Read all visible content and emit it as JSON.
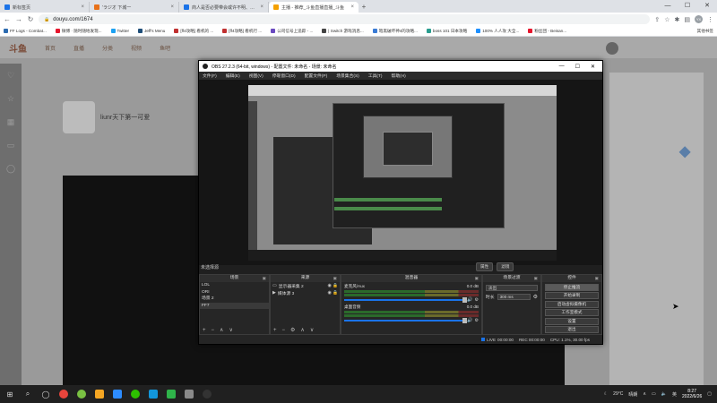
{
  "browser": {
    "tabs": [
      {
        "title": "新标签页",
        "color": "#1a73e8",
        "active": false
      },
      {
        "title": "'ラジオ 下城一 ",
        "color": "#e8711a",
        "active": false
      },
      {
        "title": "商人是否必要带会或许不明、通过",
        "color": "#1a73e8",
        "active": false
      },
      {
        "title": "主播 - 推荐_斗鱼直播直播_斗鱼",
        "color": "#f4a000",
        "active": true
      }
    ],
    "new_tab": "+",
    "address": "douyu.com/1674",
    "window_controls": {
      "minimize": "—",
      "maximize": "☐",
      "close": "✕"
    },
    "profile": "YX"
  },
  "bookmarks": [
    {
      "label": "FF Logs - Combat...",
      "color": "#2c6bb0"
    },
    {
      "label": "微博 · 随时随地发现...",
      "color": "#e6162d"
    },
    {
      "label": "Twitter",
      "color": "#1da1f2"
    },
    {
      "label": "Jeff's Menu",
      "color": "#1f4e79"
    },
    {
      "label": "[ff4攻略] 看机的 ...",
      "color": "#c03030"
    },
    {
      "label": "[ff4攻略] 看机行 ...",
      "color": "#c03030"
    },
    {
      "label": "公司信号上追踪 - ...",
      "color": "#6a4ac0"
    },
    {
      "label": "| Switch 游戏消息...",
      "color": "#444"
    },
    {
      "label": "暗黑破坏神4的攻略...",
      "color": "#3a7bd5"
    },
    {
      "label": "boss 101 日本攻略",
      "color": "#2a9d8f"
    },
    {
      "label": "100% 人人攻 大全...",
      "color": "#1e90ff"
    },
    {
      "label": "粉丝团 - Beisan...",
      "color": "#e6162d"
    }
  ],
  "bookmarks_other": "其他书签",
  "douyu": {
    "logo": "斗鱼",
    "nav": [
      "首页",
      "直播",
      "分类",
      "视频",
      "鱼吧"
    ],
    "room_name": "liunr天下第一可爱",
    "left_icons": [
      "heart-icon",
      "star-icon",
      "grid-icon",
      "chat-icon",
      "user-icon"
    ]
  },
  "obs": {
    "title": "OBS 27.2.3 (64-bit, windows) - 配置文件: 未命名 - 场景: 未命名",
    "menu": [
      "文件(F)",
      "编辑(E)",
      "视图(V)",
      "停靠窗口(D)",
      "配置文件(P)",
      "场景集合(S)",
      "工具(T)",
      "帮助(H)"
    ],
    "scene_label": "未选择源",
    "mid_buttons": [
      "属性",
      "滤镜"
    ],
    "docks": {
      "scenes": {
        "title": "场景",
        "items": [
          "LOL",
          "ORI",
          "场景 2",
          "FF7"
        ],
        "selected": 3
      },
      "sources": {
        "title": "来源",
        "items": [
          {
            "label": "显示器采集 2",
            "icon": "monitor-icon"
          },
          {
            "label": "媒体源 3",
            "icon": "media-icon"
          }
        ]
      },
      "mixer": {
        "title": "混音器",
        "channels": [
          {
            "name": "麦克风/Aux",
            "db": "0.0 dB"
          },
          {
            "name": "桌面音频",
            "db": "0.0 dB"
          }
        ]
      },
      "transitions": {
        "title": "场景过渡",
        "type": "淡出",
        "duration_label": "时长",
        "duration": "300 ms"
      },
      "controls": {
        "title": "控件",
        "buttons": [
          "停止推流",
          "开始录制",
          "启动虚拟摄像机",
          "工作室模式",
          "设置",
          "退出"
        ],
        "active": 0
      }
    },
    "status": {
      "live_label": "LIVE",
      "live_time": "00:00:00",
      "rec_label": "REC",
      "rec_time": "00:00:00",
      "cpu": "CPU: 1.1%, 30.00 fps"
    }
  },
  "taskbar": {
    "weather": "29°C",
    "weather_desc": "晴朗",
    "lang": "英",
    "time": "8:27",
    "date": "2022/6/26"
  }
}
